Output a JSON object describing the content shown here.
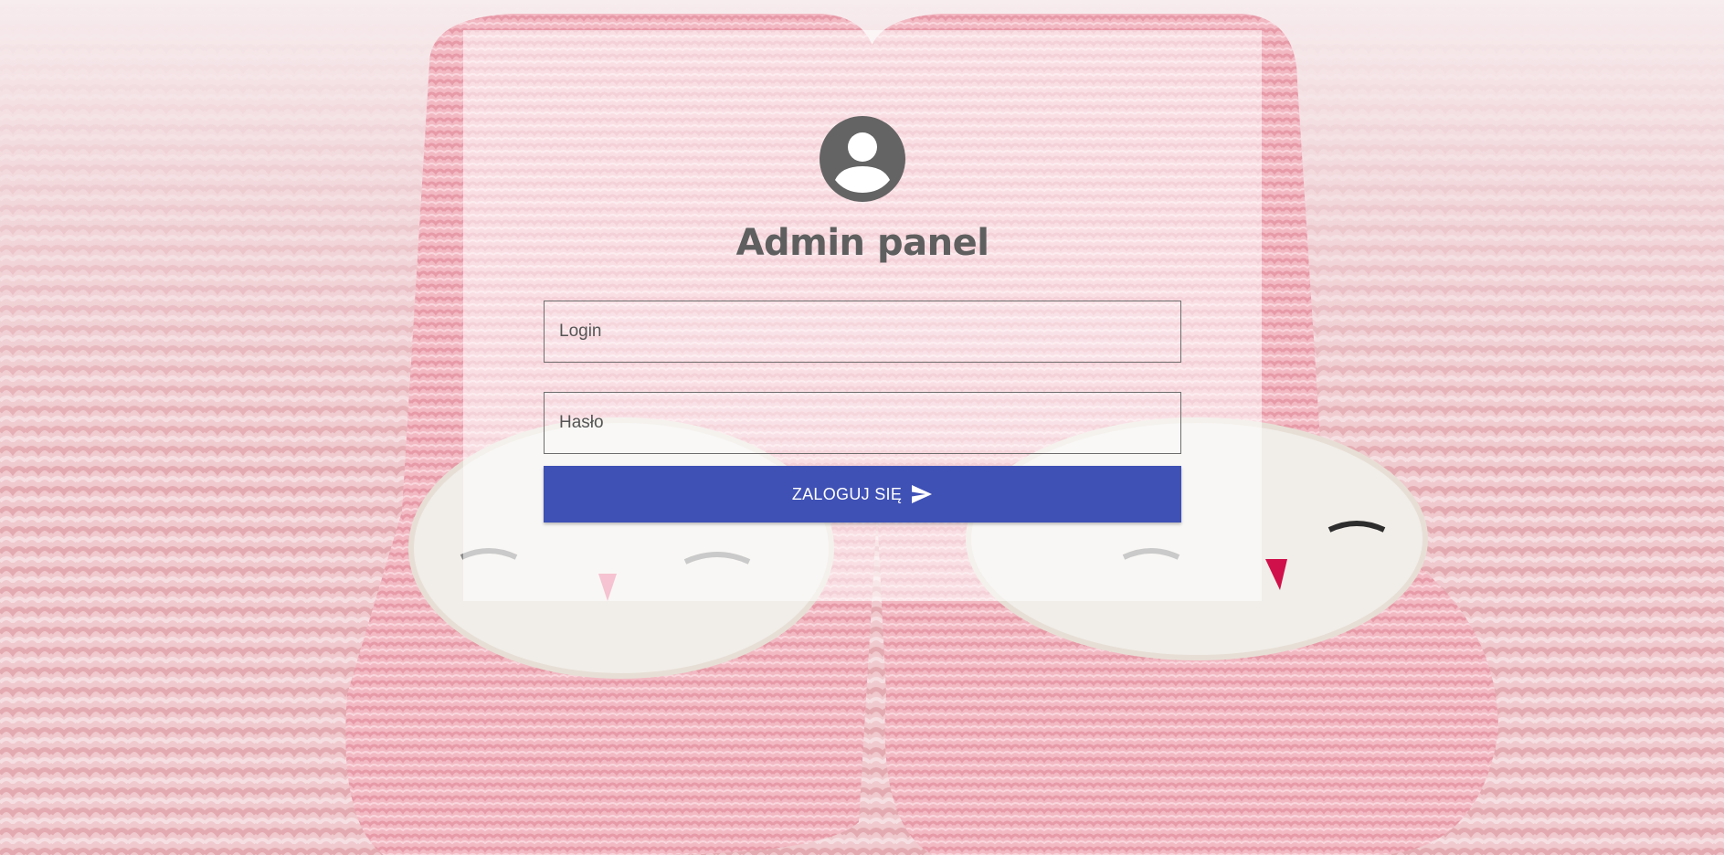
{
  "page": {
    "title": "Admin panel"
  },
  "form": {
    "login_placeholder": "Login",
    "password_placeholder": "Hasło",
    "submit_label": "ZALOGUJ SIĘ",
    "submit_icon": "send-icon",
    "avatar_icon": "account-circle-icon"
  },
  "colors": {
    "accent": "#3f51b5",
    "title": "#5f5f5f",
    "avatar": "#646464"
  }
}
